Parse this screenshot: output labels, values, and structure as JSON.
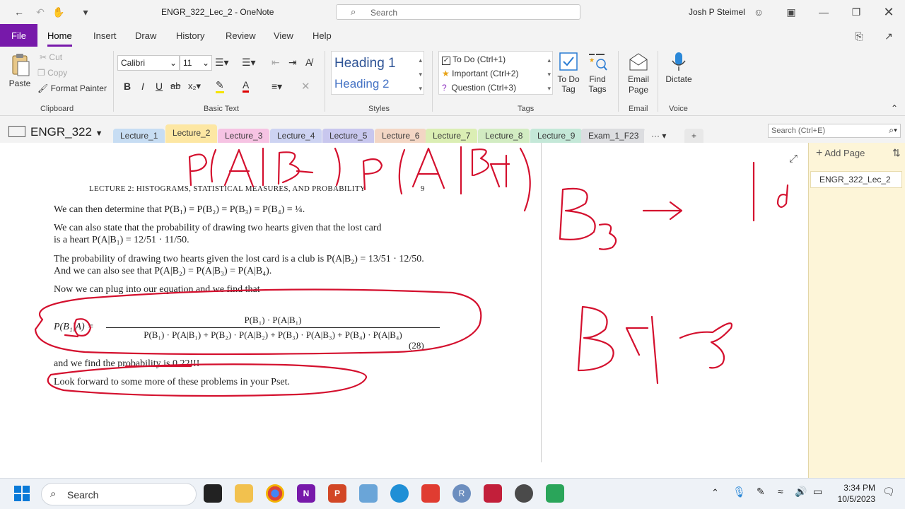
{
  "window": {
    "title": "ENGR_322_Lec_2  -  OneNote",
    "search_placeholder": "Search",
    "user_name": "Josh P Steimel"
  },
  "menu": {
    "file": "File",
    "tabs": [
      "Home",
      "Insert",
      "Draw",
      "History",
      "Review",
      "View",
      "Help"
    ],
    "active_tab": "Home"
  },
  "ribbon": {
    "clipboard": {
      "paste": "Paste",
      "cut": "Cut",
      "copy": "Copy",
      "format_painter": "Format Painter",
      "label": "Clipboard"
    },
    "basic_text": {
      "font": "Calibri",
      "size": "11",
      "label": "Basic Text"
    },
    "styles": {
      "heading1": "Heading 1",
      "heading2": "Heading 2",
      "label": "Styles"
    },
    "tags": {
      "todo": "To Do (Ctrl+1)",
      "important": "Important (Ctrl+2)",
      "question": "Question (Ctrl+3)",
      "todo_tag": "To Do Tag",
      "find_tags": "Find Tags",
      "label": "Tags"
    },
    "email": {
      "button": "Email Page",
      "label": "Email"
    },
    "voice": {
      "button": "Dictate",
      "label": "Voice"
    }
  },
  "notebook": {
    "name": "ENGR_322",
    "sections": [
      {
        "name": "Lecture_1",
        "color": "#c7ddf3"
      },
      {
        "name": "Lecture_2",
        "color": "#fde7a3"
      },
      {
        "name": "Lecture_3",
        "color": "#f6c3e3"
      },
      {
        "name": "Lecture_4",
        "color": "#cdd3f2"
      },
      {
        "name": "Lecture_5",
        "color": "#c8c7ee"
      },
      {
        "name": "Lecture_6",
        "color": "#f3d6c4"
      },
      {
        "name": "Lecture_7",
        "color": "#dbeeb4"
      },
      {
        "name": "Lecture_8",
        "color": "#d2ecc2"
      },
      {
        "name": "Lecture_9",
        "color": "#c4e8d8"
      },
      {
        "name": "Exam_1_F23",
        "color": "#dcdde0"
      }
    ],
    "active_section": "Lecture_2",
    "more": "···",
    "add": "+",
    "page_search_placeholder": "Search (Ctrl+E)"
  },
  "pages": {
    "add_page": "Add Page",
    "items": [
      "ENGR_322_Lec_2"
    ]
  },
  "document": {
    "header": "LECTURE 2:  HISTOGRAMS, STATISTICAL MEASURES, AND PROBABILITY",
    "page_number": "9",
    "line1": "We can then determine that P(B₁) = P(B₂) = P(B₃) = P(B₄) = ¼.",
    "line2": "We can also state that the probability of drawing two hearts given that the lost card",
    "line3": "is a heart P(A|B₁) = 12/51 · 11/50.",
    "line4": "The probability of drawing two hearts given the lost card is a club is P(A|B₂) = 13/51 · 12/50.",
    "line5": "And we can also see that P(A|B₂) = P(A|B₃) = P(A|B₄).",
    "line6": "Now we can plug into our equation and we find that",
    "eq_lhs": "P(B₁|A) =",
    "eq_num": "P(B₁) · P(A|B₁)",
    "eq_den": "P(B₁) · P(A|B₁) + P(B₂) · P(A|B₂) + P(B₃) · P(A|B₃) + P(B₄) · P(A|B₄)",
    "eq_tag": "(28)",
    "line7": "and we find the probability is 0.22!!!",
    "line8": "Look forward to some more of these problems in your Pset."
  },
  "taskbar": {
    "search": "Search",
    "time": "3:34 PM",
    "date": "10/5/2023"
  }
}
